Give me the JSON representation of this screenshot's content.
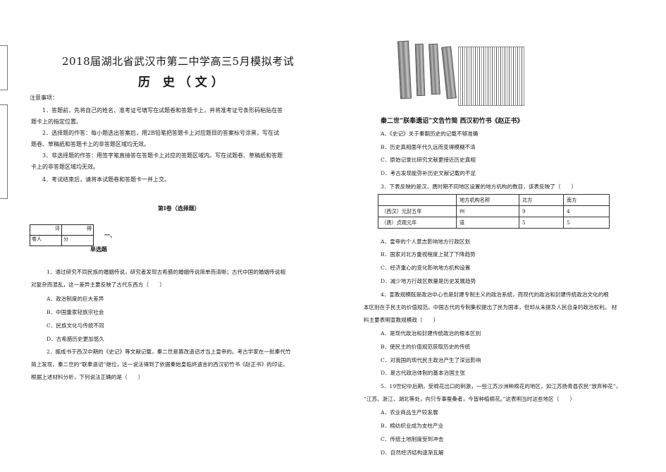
{
  "header": {
    "title": "2018届湖北省武汉市第二中学高三5月模拟考试",
    "subject": "历 史（文）"
  },
  "notes": {
    "heading": "注意事项：",
    "lines": [
      "1．答题前，先将自己的姓名、准考证号填写在试题卷和答题卡上，并将准考证号条形码粘贴在答",
      "题卡上的指定位置。",
      "2．选择题的作答：每小题选出答案后，用2B铅笔把答题卡上对应题目的答案标号涂黑，写在试",
      "题卷、草稿纸和答题卡上的非答题区域均无效。",
      "3．非选择题的作答：用签字笔直接答在答题卡上对应的答题区域内。写在试题卷、草稿纸和答题",
      "卡上的非答题区域均无效。",
      "4．考试结束后，请将本试题卷和答题卡一并上交。"
    ]
  },
  "section": {
    "title": "第Ⅰ卷（选择题）",
    "score_table": {
      "c1": "评",
      "c2": "得",
      "c3": "卷人",
      "c4": "分"
    },
    "part_num": "一、",
    "part_name": "单选题"
  },
  "left_questions": [
    {
      "lines": [
        "1．通过研究不同民族的婚姻传说，研究者发现古希腊的婚姻传说简单而清晰；古代中国的婚姻传说相",
        "对复杂而混乱，这一差异主要反映了古代东西方（　　）"
      ],
      "options": [
        "A．政治制度的巨大差异",
        "B．中国重家轻族宗社会",
        "C．民族文化与传统不同",
        "D．古希腊历史更加悠久"
      ]
    },
    {
      "lines": [
        "2．据成书于西汉中期的《史记》等文献记载，秦二世是篡改遗诏才当上皇帝的。考古学家在一批秦代竹",
        "简上发现，秦二世的“联奉遗诏”继位，这一说法得到了依据秦始皇临终遗言的西汉初竹书《赵正书》的印证。",
        "根据上述材料分析，下列说法正确的是（　　）"
      ]
    }
  ],
  "right": {
    "caption": "秦二世“朕奉遗诏”文告竹简 西汉初竹书《赵正书》",
    "q2_options": [
      "A．《史记》关于秦朝历史的记载不够准确",
      "B．历史真相面年代久远而变得模糊不清",
      "C．原始记录比研究文献更接近历史真相",
      "D．考古发现能弥补历史文献记载的不足"
    ],
    "q3": "3．下表反映的是汉、唐时期不同地区设置的地方机构的数目，该表反映了（　　）",
    "table": {
      "headers": [
        "",
        "地方机构名称",
        "北方",
        "南方"
      ],
      "rows": [
        [
          "（西汉）元封五年",
          "州",
          "9",
          "4"
        ],
        [
          "（唐）贞观元年",
          "道",
          "5",
          "5"
        ]
      ]
    },
    "q3_options": [
      "A．皇帝的个人意志影响地方行政区划",
      "B．国家对北方重视程度上就了下降趋势",
      "C．经济重心的变化影响地方机构设置",
      "D．减少地方行政区数量是历史发展趋势"
    ],
    "q4_lines": [
      "4．宣教规模既是政治中心也是封建专制主义的政治系统，而现代的政治和封建传统政治文化的根",
      "本区别在于民主的价值规范。中国古代的专制集权提出了民为国本，但却从未提及人民自身的政治权利。 材",
      "料主要表明宣教规模政（　　）"
    ],
    "q4_options": [
      "A．是现代政治和封建传统政治的根本区别",
      "B．使民主的价值规范获取历史的传统",
      "C．对我国的现代民主政治产生了深远影响",
      "D．是古代政治体制的基本治国主张"
    ],
    "q5_lines": [
      "5．19世纪中后期，受棉花出口的刺激，一些江苏沙洲种棉花的地区，如江苏扬青县农民“放弃种花”，",
      "“江苏、浙江、湖北等处，向只专事蚕桑者，今皆种植棉花。”这表明当时这些地区（　　）"
    ],
    "q5_options": [
      "A．农业商品生产较发展",
      "B．棉纺织业成为支柱产业",
      "C．传统土地制度受到冲击",
      "D．自然经济结构逐渐瓦解"
    ]
  }
}
